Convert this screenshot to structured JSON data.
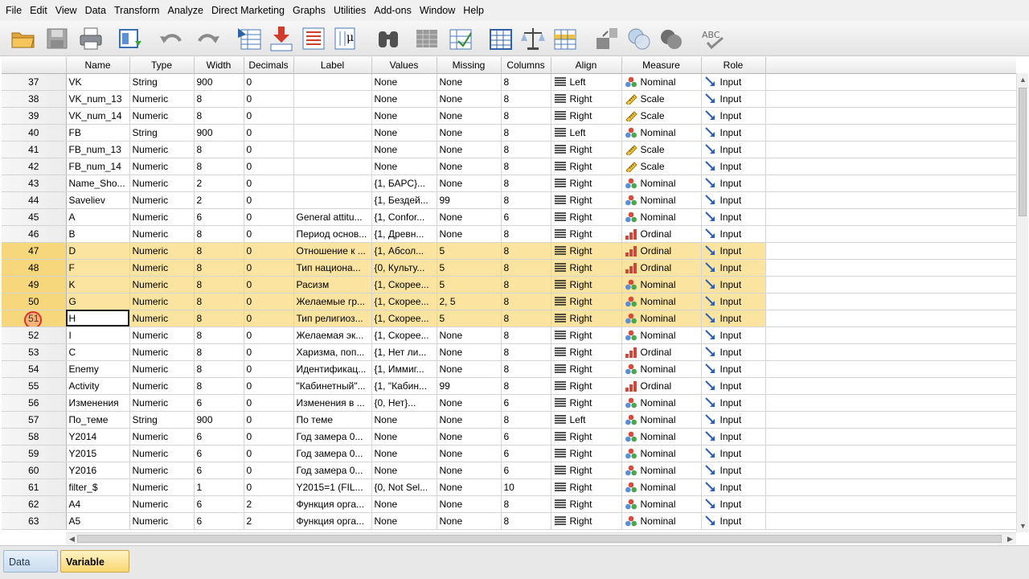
{
  "menu": [
    "File",
    "Edit",
    "View",
    "Data",
    "Transform",
    "Analyze",
    "Direct Marketing",
    "Graphs",
    "Utilities",
    "Add-ons",
    "Window",
    "Help"
  ],
  "columns": [
    "Name",
    "Type",
    "Width",
    "Decimals",
    "Label",
    "Values",
    "Missing",
    "Columns",
    "Align",
    "Measure",
    "Role"
  ],
  "rows": [
    {
      "n": "37",
      "name": "VK",
      "type": "String",
      "width": "900",
      "dec": "0",
      "label": "",
      "values": "None",
      "missing": "None",
      "cols": "8",
      "align": "Left",
      "measure": "Nominal",
      "role": "Input"
    },
    {
      "n": "38",
      "name": "VK_num_13",
      "type": "Numeric",
      "width": "8",
      "dec": "0",
      "label": "",
      "values": "None",
      "missing": "None",
      "cols": "8",
      "align": "Right",
      "measure": "Scale",
      "role": "Input"
    },
    {
      "n": "39",
      "name": "VK_num_14",
      "type": "Numeric",
      "width": "8",
      "dec": "0",
      "label": "",
      "values": "None",
      "missing": "None",
      "cols": "8",
      "align": "Right",
      "measure": "Scale",
      "role": "Input"
    },
    {
      "n": "40",
      "name": "FB",
      "type": "String",
      "width": "900",
      "dec": "0",
      "label": "",
      "values": "None",
      "missing": "None",
      "cols": "8",
      "align": "Left",
      "measure": "Nominal",
      "role": "Input"
    },
    {
      "n": "41",
      "name": "FB_num_13",
      "type": "Numeric",
      "width": "8",
      "dec": "0",
      "label": "",
      "values": "None",
      "missing": "None",
      "cols": "8",
      "align": "Right",
      "measure": "Scale",
      "role": "Input"
    },
    {
      "n": "42",
      "name": "FB_num_14",
      "type": "Numeric",
      "width": "8",
      "dec": "0",
      "label": "",
      "values": "None",
      "missing": "None",
      "cols": "8",
      "align": "Right",
      "measure": "Scale",
      "role": "Input"
    },
    {
      "n": "43",
      "name": "Name_Sho...",
      "type": "Numeric",
      "width": "2",
      "dec": "0",
      "label": "",
      "values": "{1, БАРС}...",
      "missing": "None",
      "cols": "8",
      "align": "Right",
      "measure": "Nominal",
      "role": "Input"
    },
    {
      "n": "44",
      "name": "Saveliev",
      "type": "Numeric",
      "width": "2",
      "dec": "0",
      "label": "",
      "values": "{1, Бездей...",
      "missing": "99",
      "cols": "8",
      "align": "Right",
      "measure": "Nominal",
      "role": "Input"
    },
    {
      "n": "45",
      "name": "A",
      "type": "Numeric",
      "width": "6",
      "dec": "0",
      "label": "General attitu...",
      "values": "{1, Confor...",
      "missing": "None",
      "cols": "6",
      "align": "Right",
      "measure": "Nominal",
      "role": "Input"
    },
    {
      "n": "46",
      "name": "B",
      "type": "Numeric",
      "width": "8",
      "dec": "0",
      "label": "Период основ...",
      "values": "{1, Древн...",
      "missing": "None",
      "cols": "8",
      "align": "Right",
      "measure": "Ordinal",
      "role": "Input"
    },
    {
      "n": "47",
      "name": "D",
      "type": "Numeric",
      "width": "8",
      "dec": "0",
      "label": "Отношение к ...",
      "values": "{1, Абсол...",
      "missing": "5",
      "cols": "8",
      "align": "Right",
      "measure": "Ordinal",
      "role": "Input",
      "sel": true
    },
    {
      "n": "48",
      "name": "F",
      "type": "Numeric",
      "width": "8",
      "dec": "0",
      "label": "Тип национа...",
      "values": "{0, Культу...",
      "missing": "5",
      "cols": "8",
      "align": "Right",
      "measure": "Ordinal",
      "role": "Input",
      "sel": true
    },
    {
      "n": "49",
      "name": "K",
      "type": "Numeric",
      "width": "8",
      "dec": "0",
      "label": "Расизм",
      "values": "{1, Скорее...",
      "missing": "5",
      "cols": "8",
      "align": "Right",
      "measure": "Nominal",
      "role": "Input",
      "sel": true
    },
    {
      "n": "50",
      "name": "G",
      "type": "Numeric",
      "width": "8",
      "dec": "0",
      "label": "Желаемые гр...",
      "values": "{1, Скорее...",
      "missing": "2, 5",
      "cols": "8",
      "align": "Right",
      "measure": "Nominal",
      "role": "Input",
      "sel": true
    },
    {
      "n": "51",
      "name": "H",
      "type": "Numeric",
      "width": "8",
      "dec": "0",
      "label": "Тип религиоз...",
      "values": "{1, Скорее...",
      "missing": "5",
      "cols": "8",
      "align": "Right",
      "measure": "Nominal",
      "role": "Input",
      "sel": true,
      "active": true
    },
    {
      "n": "52",
      "name": "I",
      "type": "Numeric",
      "width": "8",
      "dec": "0",
      "label": "Желаемая эк...",
      "values": "{1, Скорее...",
      "missing": "None",
      "cols": "8",
      "align": "Right",
      "measure": "Nominal",
      "role": "Input"
    },
    {
      "n": "53",
      "name": "C",
      "type": "Numeric",
      "width": "8",
      "dec": "0",
      "label": "Харизма, поп...",
      "values": "{1, Нет ли...",
      "missing": "None",
      "cols": "8",
      "align": "Right",
      "measure": "Ordinal",
      "role": "Input"
    },
    {
      "n": "54",
      "name": "Enemy",
      "type": "Numeric",
      "width": "8",
      "dec": "0",
      "label": "Идентификац...",
      "values": "{1, Иммиг...",
      "missing": "None",
      "cols": "8",
      "align": "Right",
      "measure": "Nominal",
      "role": "Input"
    },
    {
      "n": "55",
      "name": "Activity",
      "type": "Numeric",
      "width": "8",
      "dec": "0",
      "label": "\"Кабинетный\"...",
      "values": "{1, \"Кабин...",
      "missing": "99",
      "cols": "8",
      "align": "Right",
      "measure": "Ordinal",
      "role": "Input"
    },
    {
      "n": "56",
      "name": "Изменения",
      "type": "Numeric",
      "width": "6",
      "dec": "0",
      "label": "Изменения в ...",
      "values": "{0, Нет}...",
      "missing": "None",
      "cols": "6",
      "align": "Right",
      "measure": "Nominal",
      "role": "Input"
    },
    {
      "n": "57",
      "name": "По_теме",
      "type": "String",
      "width": "900",
      "dec": "0",
      "label": "По теме",
      "values": "None",
      "missing": "None",
      "cols": "8",
      "align": "Left",
      "measure": "Nominal",
      "role": "Input"
    },
    {
      "n": "58",
      "name": "Y2014",
      "type": "Numeric",
      "width": "6",
      "dec": "0",
      "label": "Год замера 0...",
      "values": "None",
      "missing": "None",
      "cols": "6",
      "align": "Right",
      "measure": "Nominal",
      "role": "Input"
    },
    {
      "n": "59",
      "name": "Y2015",
      "type": "Numeric",
      "width": "6",
      "dec": "0",
      "label": "Год замера 0...",
      "values": "None",
      "missing": "None",
      "cols": "6",
      "align": "Right",
      "measure": "Nominal",
      "role": "Input"
    },
    {
      "n": "60",
      "name": "Y2016",
      "type": "Numeric",
      "width": "6",
      "dec": "0",
      "label": "Год замера 0...",
      "values": "None",
      "missing": "None",
      "cols": "6",
      "align": "Right",
      "measure": "Nominal",
      "role": "Input"
    },
    {
      "n": "61",
      "name": "filter_$",
      "type": "Numeric",
      "width": "1",
      "dec": "0",
      "label": "Y2015=1 (FIL...",
      "values": "{0, Not Sel...",
      "missing": "None",
      "cols": "10",
      "align": "Right",
      "measure": "Nominal",
      "role": "Input"
    },
    {
      "n": "62",
      "name": "A4",
      "type": "Numeric",
      "width": "6",
      "dec": "2",
      "label": "Функция орга...",
      "values": "None",
      "missing": "None",
      "cols": "8",
      "align": "Right",
      "measure": "Nominal",
      "role": "Input"
    },
    {
      "n": "63",
      "name": "A5",
      "type": "Numeric",
      "width": "6",
      "dec": "2",
      "label": "Функция орга...",
      "values": "None",
      "missing": "None",
      "cols": "8",
      "align": "Right",
      "measure": "Nominal",
      "role": "Input"
    }
  ],
  "tabs": {
    "data_view": "Data View",
    "variable_view": "Variable View"
  },
  "icons": {
    "align": "align-lines-icon",
    "nominal": "nominal-circles-icon",
    "scale": "ruler-icon",
    "ordinal": "bars-icon",
    "role": "input-arrow-icon"
  },
  "colors": {
    "selected_row": "#fbe3a0",
    "selected_header": "#f7d77c",
    "active_tab": "#f8d670"
  }
}
